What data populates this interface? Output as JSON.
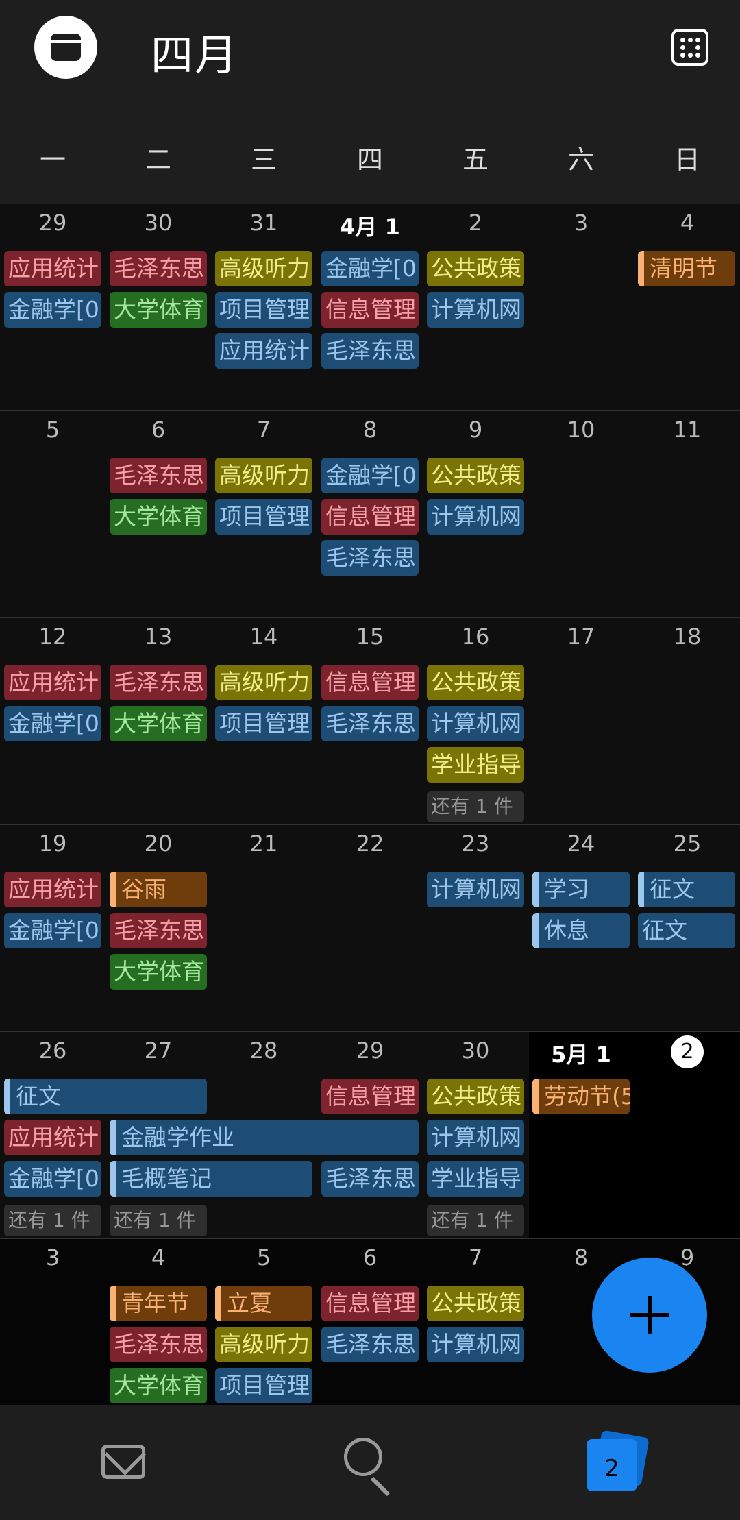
{
  "header": {
    "title": "四月"
  },
  "weekdays": [
    "一",
    "二",
    "三",
    "四",
    "五",
    "六",
    "日"
  ],
  "weeks": [
    {
      "days": [
        "29",
        "30",
        "31",
        "4月 1",
        "2",
        "3",
        "4"
      ]
    },
    {
      "days": [
        "5",
        "6",
        "7",
        "8",
        "9",
        "10",
        "11"
      ]
    },
    {
      "days": [
        "12",
        "13",
        "14",
        "15",
        "16",
        "17",
        "18"
      ]
    },
    {
      "days": [
        "19",
        "20",
        "21",
        "22",
        "23",
        "24",
        "25"
      ]
    },
    {
      "days": [
        "26",
        "27",
        "28",
        "29",
        "30",
        "5月 1",
        "2"
      ]
    },
    {
      "days": [
        "3",
        "4",
        "5",
        "6",
        "7",
        "8",
        "9"
      ]
    }
  ],
  "events": {
    "yytj": "应用统计",
    "mzd": "毛泽东思",
    "gjtl": "高级听力",
    "jrx": "金融学[0",
    "ggzc": "公共政策",
    "qmj": "清明节",
    "dxty": "大学体育",
    "xmgl": "项目管理",
    "xxgl": "信息管理",
    "jsjw": "计算机网",
    "xyzd": "学业指导",
    "more1": "还有 1 件",
    "gy": "谷雨",
    "xx": "学习",
    "zw": "征文",
    "xiuxi": "休息",
    "ldj": "劳动节(5",
    "jrxzy": "金融学作业",
    "mgbj": "毛概笔记",
    "qnj": "青年节",
    "lx": "立夏"
  },
  "bottom_nav": {
    "calendar_badge": "2"
  },
  "colors": {
    "header_bg": "#1e1e1e",
    "accent": "#1a85f0",
    "event_red": "#7c232d",
    "event_blue": "#1d4d74",
    "event_olive": "#7a7406",
    "event_green": "#256d20",
    "event_orange": "#6f3d0c"
  }
}
